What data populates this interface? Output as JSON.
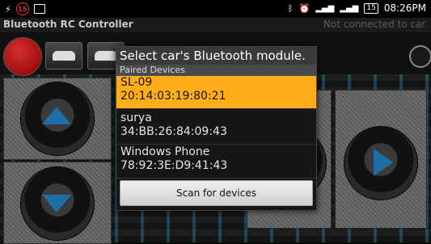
{
  "status_bar": {
    "notification_count": "15",
    "battery": "15",
    "time": "08:26PM",
    "icons": [
      "usb-icon",
      "notification-badge",
      "image-icon",
      "bluetooth-icon",
      "alarm-icon",
      "signal-icon",
      "signal-icon-2",
      "battery-icon"
    ]
  },
  "app": {
    "title": "Bluetooth RC Controller",
    "connection_status": "Not connected to car."
  },
  "dialog": {
    "title": "Select car's Bluetooth module.",
    "section_label": "Paired Devices",
    "devices": [
      {
        "name": "SL-09",
        "address": "20:14:03:19:80:21"
      },
      {
        "name": "surya",
        "address": "34:BB:26:84:09:43"
      },
      {
        "name": "Windows Phone",
        "address": "78:92:3E:D9:41:43"
      }
    ],
    "scan_label": "Scan for devices"
  },
  "colors": {
    "selected_row": "#ffae1a",
    "accent_blue": "#1e6fa8",
    "record": "#c62828"
  }
}
